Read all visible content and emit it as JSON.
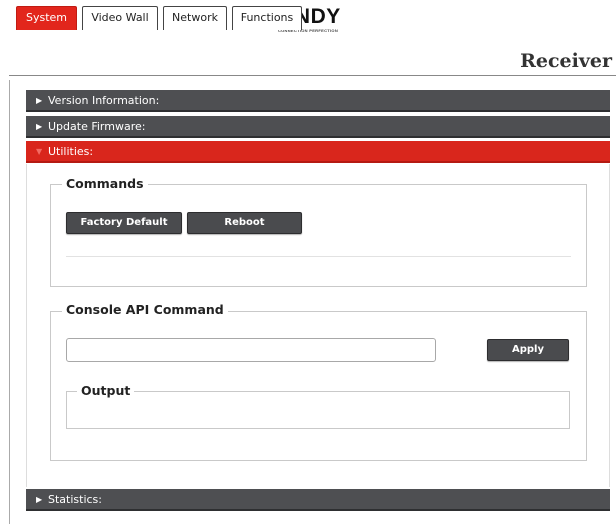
{
  "brand": {
    "logo_text": "LINDY",
    "logo_tagline": "CONNECTION PERFECTION",
    "accent_color": "#e2261c"
  },
  "tabs": [
    {
      "label": "System",
      "active": true
    },
    {
      "label": "Video Wall",
      "active": false
    },
    {
      "label": "Network",
      "active": false
    },
    {
      "label": "Functions",
      "active": false
    }
  ],
  "device_title": "Receiver",
  "sections": {
    "version": "Version Information:",
    "firmware": "Update Firmware:",
    "utilities": "Utilities:",
    "statistics": "Statistics:"
  },
  "commands": {
    "legend": "Commands",
    "factory_default_label": "Factory Default",
    "reboot_label": "Reboot"
  },
  "console_api": {
    "legend": "Console API Command",
    "input_value": "",
    "input_placeholder": "",
    "apply_label": "Apply",
    "output_legend": "Output",
    "output_text": ""
  }
}
